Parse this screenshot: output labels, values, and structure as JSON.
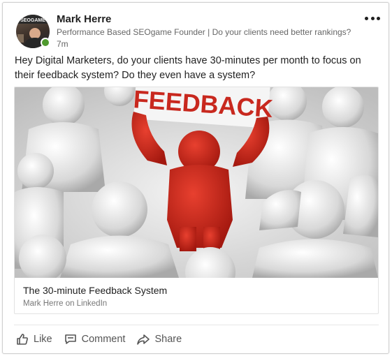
{
  "post": {
    "author": {
      "name": "Mark Herre",
      "headline": "Performance Based SEOgame Founder | Do your clients need better rankings?",
      "timestamp": "7m",
      "avatar_text": "SEOGAME",
      "status_color": "#4f9a2e"
    },
    "text": "Hey Digital Marketers, do your clients have 30-minutes per month to focus on their feedback system? Do they even have a system?",
    "more_icon": "more-horizontal-icon",
    "article": {
      "image_text": "FEEDBACK",
      "title": "The 30-minute Feedback System",
      "source": "Mark Herre on LinkedIn",
      "accent_color": "#c8281e"
    },
    "actions": [
      {
        "label": "Like",
        "icon": "thumbs-up-icon"
      },
      {
        "label": "Comment",
        "icon": "comment-icon"
      },
      {
        "label": "Share",
        "icon": "share-icon"
      }
    ]
  }
}
